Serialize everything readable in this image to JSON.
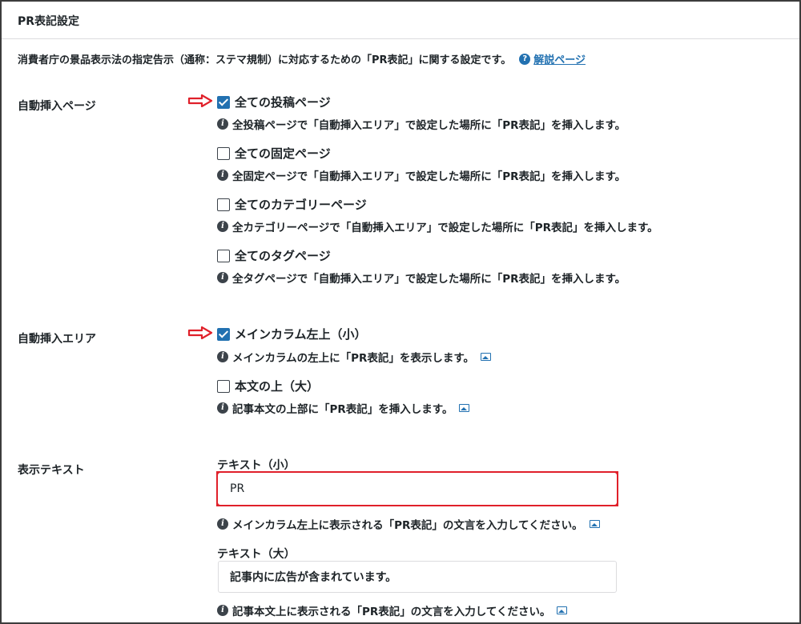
{
  "section": {
    "title": "PR表記設定",
    "description": "消費者庁の景品表示法の指定告示（通称：ステマ規制）に対応するための「PR表記」に関する設定です。",
    "help_icon": "?",
    "help_link": "解説ページ"
  },
  "auto_insert_page": {
    "label": "自動挿入ページ",
    "options": [
      {
        "label": "全ての投稿ページ",
        "checked": true,
        "info": "全投稿ページで「自動挿入エリア」で設定した場所に「PR表記」を挿入します。"
      },
      {
        "label": "全ての固定ページ",
        "checked": false,
        "info": "全固定ページで「自動挿入エリア」で設定した場所に「PR表記」を挿入します。"
      },
      {
        "label": "全てのカテゴリーページ",
        "checked": false,
        "info": "全カテゴリーページで「自動挿入エリア」で設定した場所に「PR表記」を挿入します。"
      },
      {
        "label": "全てのタグページ",
        "checked": false,
        "info": "全タグページで「自動挿入エリア」で設定した場所に「PR表記」を挿入します。"
      }
    ]
  },
  "auto_insert_area": {
    "label": "自動挿入エリア",
    "options": [
      {
        "label": "メインカラム左上（小）",
        "checked": true,
        "info": "メインカラムの左上に「PR表記」を表示します。"
      },
      {
        "label": "本文の上（大）",
        "checked": false,
        "info": "記事本文の上部に「PR表記」を挿入します。"
      }
    ]
  },
  "display_text": {
    "label": "表示テキスト",
    "small": {
      "label": "テキスト（小）",
      "value": "PR",
      "info": "メインカラム左上に表示される「PR表記」の文言を入力してください。"
    },
    "large": {
      "label": "テキスト（大）",
      "value": "記事内に広告が含まれています。",
      "info": "記事本文上に表示される「PR表記」の文言を入力してください。"
    }
  },
  "colors": {
    "accent": "#2271b1",
    "annotation_red": "#e0202a",
    "text": "#1d2327"
  },
  "icons": {
    "info": "info-circle-icon",
    "help": "question-circle-icon",
    "image": "image-preview-icon",
    "arrow": "red-arrow-right-icon"
  }
}
